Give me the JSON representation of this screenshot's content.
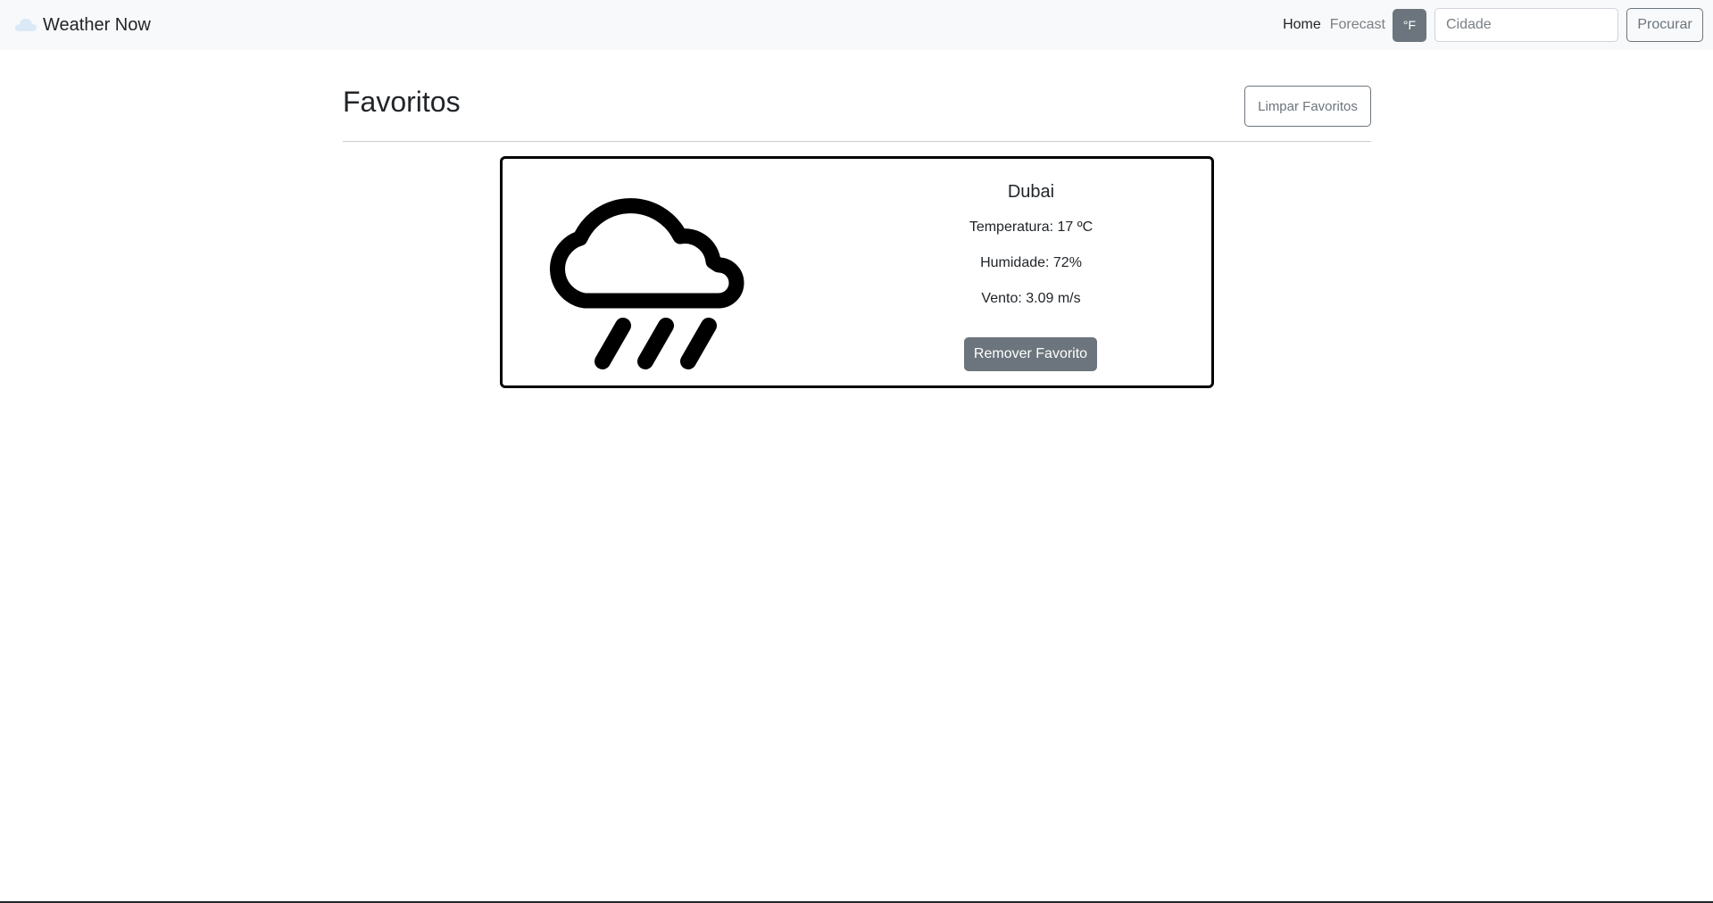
{
  "navbar": {
    "brand_icon": "cloud-icon",
    "brand_text": "Weather Now",
    "links": [
      {
        "label": "Home",
        "active": true
      },
      {
        "label": "Forecast",
        "active": false
      }
    ],
    "unit_toggle_label": "°F",
    "search": {
      "value": "",
      "placeholder": "Cidade"
    },
    "search_button_label": "Procurar"
  },
  "main": {
    "title": "Favoritos",
    "clear_button_label": "Limpar Favoritos",
    "favorites": [
      {
        "icon": "rain-cloud-icon",
        "city": "Dubai",
        "temperature_text": "Temperatura: 17 ºC",
        "humidity_text": "Humidade: 72%",
        "wind_text": "Vento: 3.09 m/s",
        "remove_button_label": "Remover Favorito"
      }
    ]
  },
  "colors": {
    "navbar_bg": "#f8f9fa",
    "secondary": "#6c757d",
    "text": "#212529",
    "card_border": "#000000"
  }
}
